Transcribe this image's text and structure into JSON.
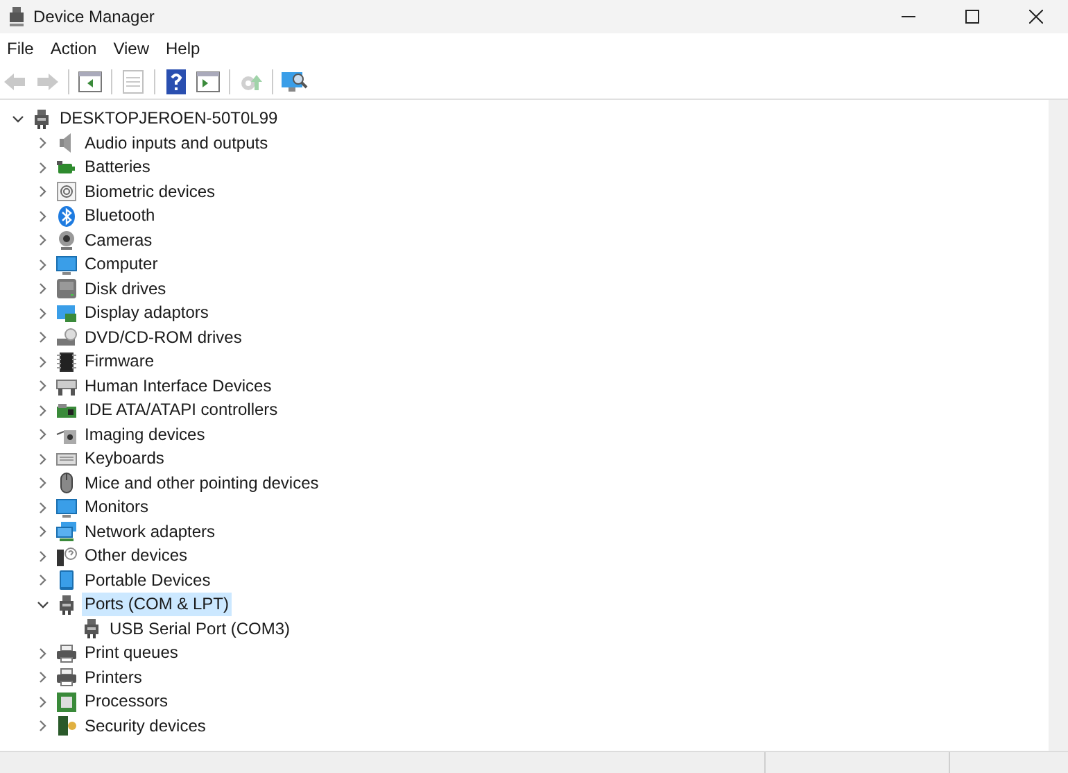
{
  "window": {
    "title": "Device Manager"
  },
  "menu": [
    "File",
    "Action",
    "View",
    "Help"
  ],
  "toolbar": [
    {
      "kind": "back",
      "disabled": true
    },
    {
      "kind": "forward",
      "disabled": true
    },
    {
      "kind": "sep"
    },
    {
      "kind": "tree",
      "disabled": false
    },
    {
      "kind": "sep"
    },
    {
      "kind": "properties",
      "disabled": true
    },
    {
      "kind": "sep"
    },
    {
      "kind": "help",
      "disabled": false
    },
    {
      "kind": "pane",
      "disabled": false
    },
    {
      "kind": "sep"
    },
    {
      "kind": "update",
      "disabled": true
    },
    {
      "kind": "sep"
    },
    {
      "kind": "scan",
      "disabled": false
    }
  ],
  "tree": {
    "label": "DESKTOPJEROEN-50T0L99",
    "expanded": true,
    "kind": "computer-tower",
    "children": [
      {
        "label": "Audio inputs and outputs",
        "kind": "speaker",
        "expanded": false,
        "selected": false
      },
      {
        "label": "Batteries",
        "kind": "battery",
        "expanded": false,
        "selected": false
      },
      {
        "label": "Biometric devices",
        "kind": "fingerprint",
        "expanded": false,
        "selected": false
      },
      {
        "label": "Bluetooth",
        "kind": "bluetooth",
        "expanded": false,
        "selected": false
      },
      {
        "label": "Cameras",
        "kind": "webcam",
        "expanded": false,
        "selected": false
      },
      {
        "label": "Computer",
        "kind": "monitor",
        "expanded": false,
        "selected": false
      },
      {
        "label": "Disk drives",
        "kind": "disk",
        "expanded": false,
        "selected": false
      },
      {
        "label": "Display adaptors",
        "kind": "display",
        "expanded": false,
        "selected": false
      },
      {
        "label": "DVD/CD-ROM drives",
        "kind": "dvd",
        "expanded": false,
        "selected": false
      },
      {
        "label": "Firmware",
        "kind": "chip",
        "expanded": false,
        "selected": false
      },
      {
        "label": "Human Interface Devices",
        "kind": "hid",
        "expanded": false,
        "selected": false
      },
      {
        "label": "IDE ATA/ATAPI controllers",
        "kind": "card",
        "expanded": false,
        "selected": false
      },
      {
        "label": "Imaging devices",
        "kind": "scanner",
        "expanded": false,
        "selected": false
      },
      {
        "label": "Keyboards",
        "kind": "keyboard",
        "expanded": false,
        "selected": false
      },
      {
        "label": "Mice and other pointing devices",
        "kind": "mouse",
        "expanded": false,
        "selected": false
      },
      {
        "label": "Monitors",
        "kind": "monitor",
        "expanded": false,
        "selected": false
      },
      {
        "label": "Network adapters",
        "kind": "network",
        "expanded": false,
        "selected": false
      },
      {
        "label": "Other devices",
        "kind": "unknown",
        "expanded": false,
        "selected": false
      },
      {
        "label": "Portable Devices",
        "kind": "phone",
        "expanded": false,
        "selected": false
      },
      {
        "label": "Ports (COM & LPT)",
        "kind": "port",
        "expanded": true,
        "selected": true,
        "children": [
          {
            "label": "USB Serial Port (COM3)",
            "kind": "port",
            "selected": false
          }
        ]
      },
      {
        "label": "Print queues",
        "kind": "printer",
        "expanded": false,
        "selected": false
      },
      {
        "label": "Printers",
        "kind": "printer",
        "expanded": false,
        "selected": false
      },
      {
        "label": "Processors",
        "kind": "cpu",
        "expanded": false,
        "selected": false
      },
      {
        "label": "Security devices",
        "kind": "security",
        "expanded": false,
        "selected": false
      }
    ]
  }
}
